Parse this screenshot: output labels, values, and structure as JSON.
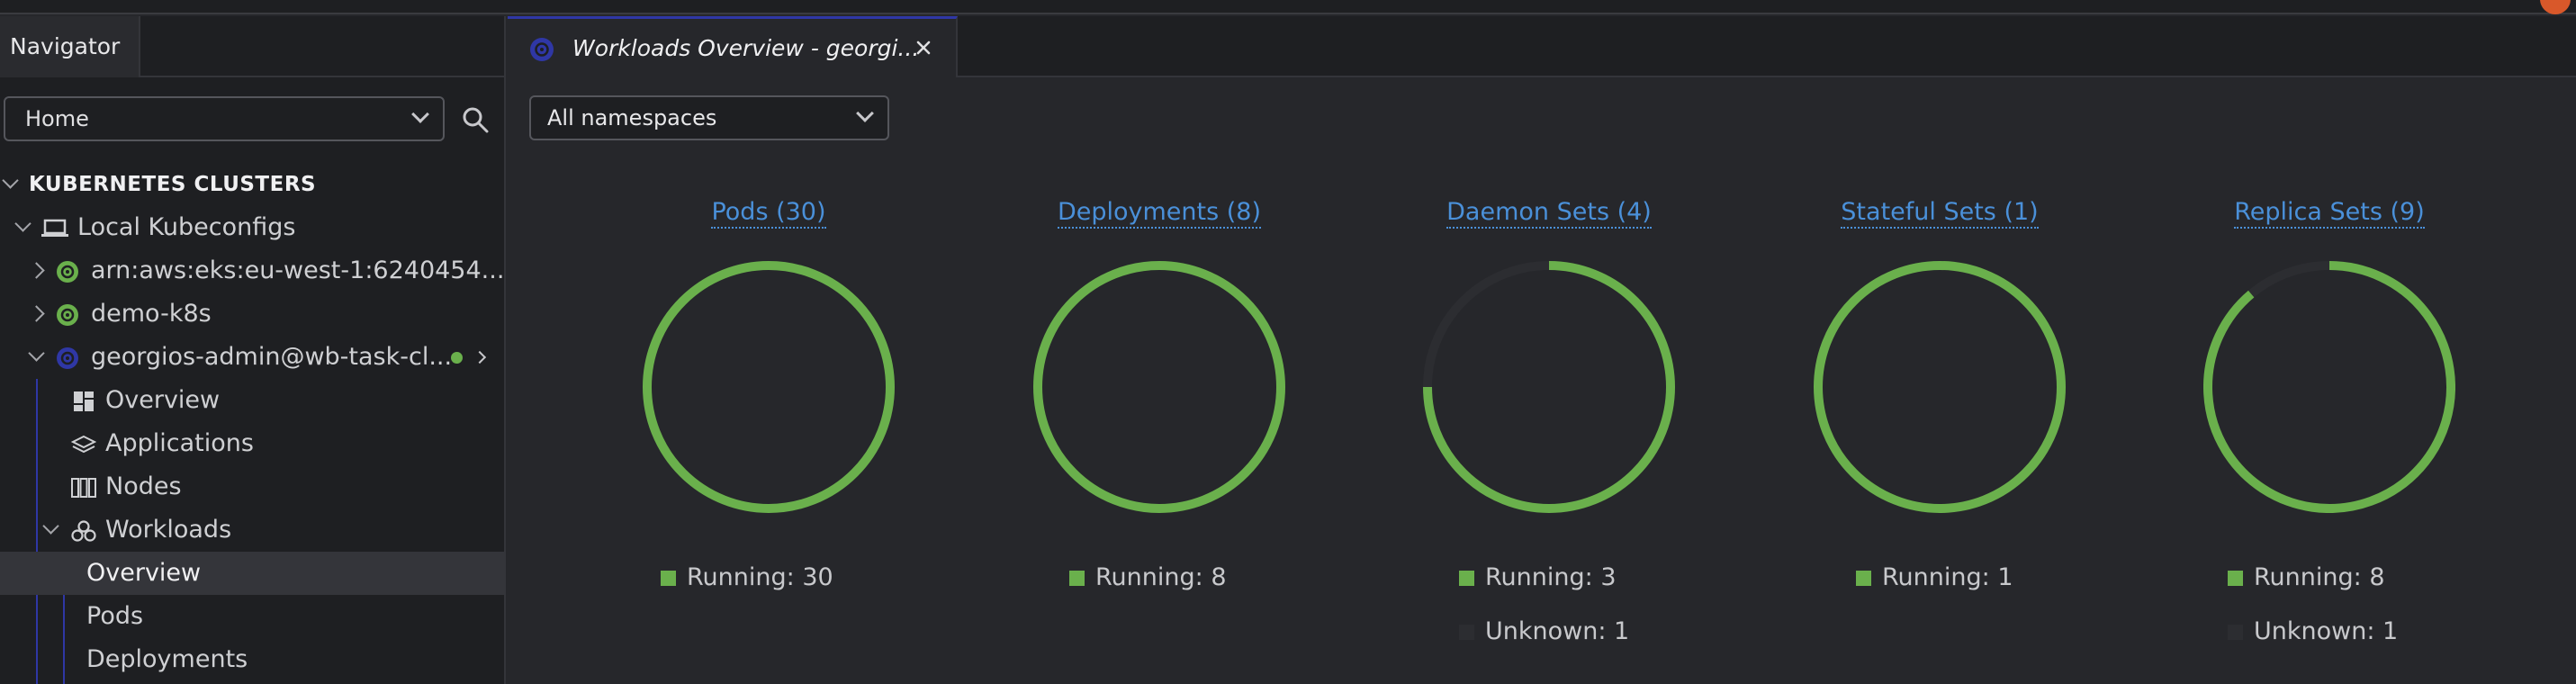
{
  "navigator": {
    "tab_label": "Navigator",
    "home_select": {
      "value": "Home"
    },
    "section_title": "KUBERNETES CLUSTERS",
    "tree": [
      {
        "label": "Local Kubeconfigs"
      },
      {
        "label": "arn:aws:eks:eu-west-1:6240454..."
      },
      {
        "label": "demo-k8s"
      },
      {
        "label": "georgios-admin@wb-task-cl..."
      },
      {
        "label": "Overview"
      },
      {
        "label": "Applications"
      },
      {
        "label": "Nodes"
      },
      {
        "label": "Workloads"
      },
      {
        "label": "Overview"
      },
      {
        "label": "Pods"
      },
      {
        "label": "Deployments"
      }
    ]
  },
  "tab": {
    "title": "Workloads Overview - georgi..."
  },
  "namespace_select": {
    "value": "All namespaces"
  },
  "colors": {
    "running": "#6ab04c",
    "unknown": "#2c2d31",
    "link": "#4a90d9",
    "accent": "#2f37a5"
  },
  "chart_data": [
    {
      "type": "pie",
      "title": "Pods (30)",
      "series": [
        {
          "name": "Running",
          "value": 30
        }
      ],
      "legend": [
        "Running: 30"
      ]
    },
    {
      "type": "pie",
      "title": "Deployments (8)",
      "series": [
        {
          "name": "Running",
          "value": 8
        }
      ],
      "legend": [
        "Running: 8"
      ]
    },
    {
      "type": "pie",
      "title": "Daemon Sets (4)",
      "series": [
        {
          "name": "Running",
          "value": 3
        },
        {
          "name": "Unknown",
          "value": 1
        }
      ],
      "legend": [
        "Running: 3",
        "Unknown: 1"
      ]
    },
    {
      "type": "pie",
      "title": "Stateful Sets (1)",
      "series": [
        {
          "name": "Running",
          "value": 1
        }
      ],
      "legend": [
        "Running: 1"
      ]
    },
    {
      "type": "pie",
      "title": "Replica Sets (9)",
      "series": [
        {
          "name": "Running",
          "value": 8
        },
        {
          "name": "Unknown",
          "value": 1
        }
      ],
      "legend": [
        "Running: 8",
        "Unknown: 1"
      ]
    }
  ]
}
